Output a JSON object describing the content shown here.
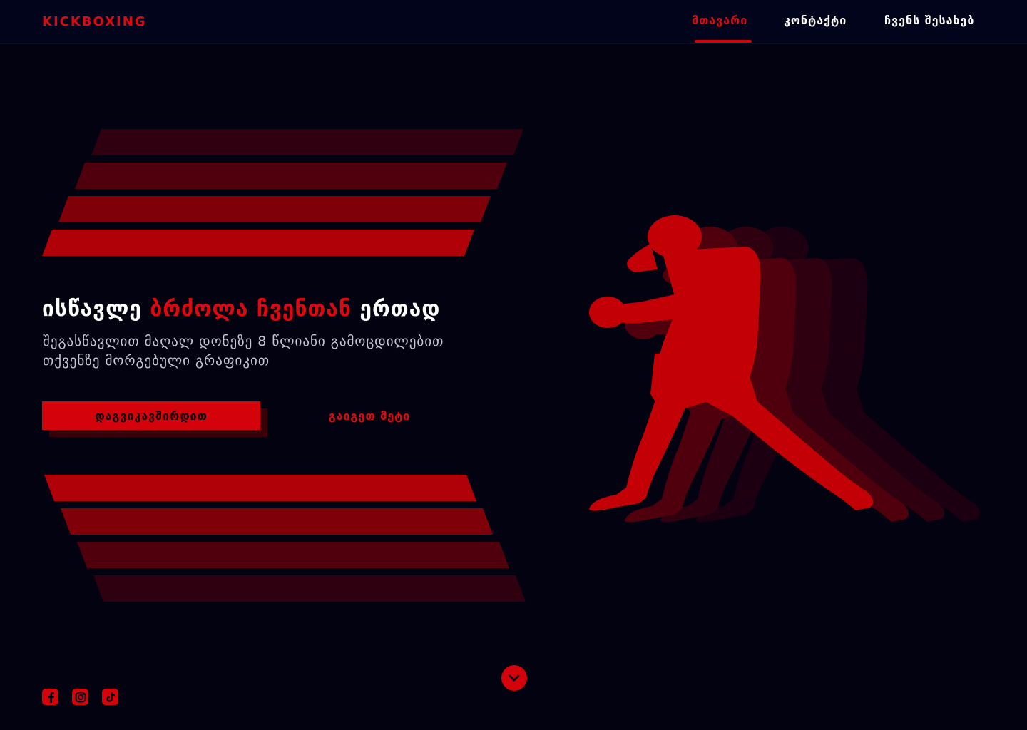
{
  "header": {
    "logo": "KICKBOXING",
    "nav": [
      {
        "label": "მთავარი",
        "active": true
      },
      {
        "label": "კონტაქტი",
        "active": false
      },
      {
        "label": "ჩვენს შესახებ",
        "active": false
      }
    ]
  },
  "hero": {
    "title_start": "ისწავლე ",
    "title_accent": "ბრძოლა ჩვენთან",
    "title_end": " ერთად",
    "subtitle": "შეგასწავლით მაღალ დონეზე 8 წლიანი გამოცდილებით თქვენზე მორგებული გრაფიკით",
    "primary_button": "დაგვიკავშირდით",
    "secondary_button": "გაიგეთ მეტი"
  },
  "colors": {
    "background": "#020211",
    "accent": "#e00710",
    "stripe_shades": [
      "#2e0010",
      "#4f000c",
      "#7f0009",
      "#b00008"
    ]
  },
  "icons": {
    "scroll": "chevron-down-icon",
    "social": [
      "facebook-icon",
      "instagram-icon",
      "tiktok-icon"
    ]
  }
}
